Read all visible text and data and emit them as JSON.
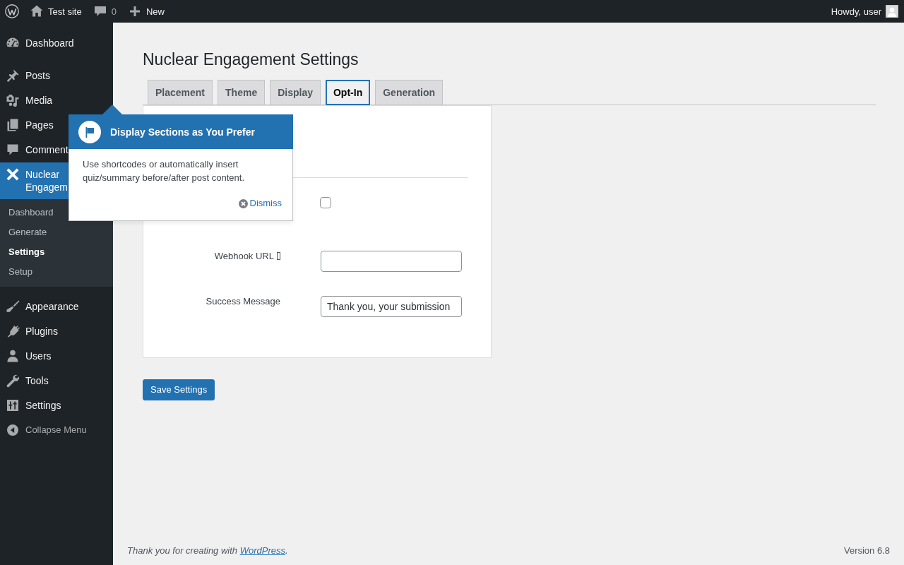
{
  "admin_bar": {
    "site_name": "Test site",
    "comment_count": "0",
    "new_label": "New",
    "greeting": "Howdy, user"
  },
  "sidebar": {
    "groups": [
      {
        "items": [
          {
            "label": "Dashboard",
            "selected": false
          }
        ]
      },
      {
        "items": [
          {
            "label": "Posts",
            "selected": false
          },
          {
            "label": "Media",
            "selected": false
          },
          {
            "label": "Pages",
            "selected": false
          },
          {
            "label": "Comment",
            "selected": false
          },
          {
            "label": "Nuclear Engagem",
            "selected": true,
            "children": [
              {
                "label": "Dashboard",
                "selected": false
              },
              {
                "label": "Generate",
                "selected": false
              },
              {
                "label": "Settings",
                "selected": true
              },
              {
                "label": "Setup",
                "selected": false
              }
            ]
          }
        ]
      },
      {
        "items": [
          {
            "label": "Appearance",
            "selected": false
          },
          {
            "label": "Plugins",
            "selected": false
          },
          {
            "label": "Users",
            "selected": false
          },
          {
            "label": "Tools",
            "selected": false
          },
          {
            "label": "Settings",
            "selected": false
          }
        ]
      }
    ],
    "collapse_label": "Collapse Menu"
  },
  "page": {
    "title": "Nuclear Engagement Settings",
    "tabs": [
      {
        "label": "Placement",
        "selected": false
      },
      {
        "label": "Theme",
        "selected": false
      },
      {
        "label": "Display",
        "selected": false
      },
      {
        "label": "Opt-In",
        "selected": true
      },
      {
        "label": "Generation",
        "selected": false
      }
    ],
    "form": {
      "rows": [
        {
          "kind": "checkbox",
          "checked": false,
          "help_icon": false
        },
        {
          "kind": "text",
          "label": "Webhook URL",
          "help_icon": true
        },
        {
          "kind": "text",
          "label": "Success Message",
          "value": "Thank you, your submission",
          "help_icon": false
        }
      ]
    },
    "save_button": "Save Settings"
  },
  "pointer": {
    "title": "Display Sections as You Prefer",
    "body": "Use shortcodes or automatically insert quiz/summary before/after post content.",
    "dismiss": "Dismiss"
  },
  "footer": {
    "credit": "Thank you for creating with",
    "credit_link": "WordPress",
    "credit_end": ".",
    "version": "Version 6.8"
  }
}
